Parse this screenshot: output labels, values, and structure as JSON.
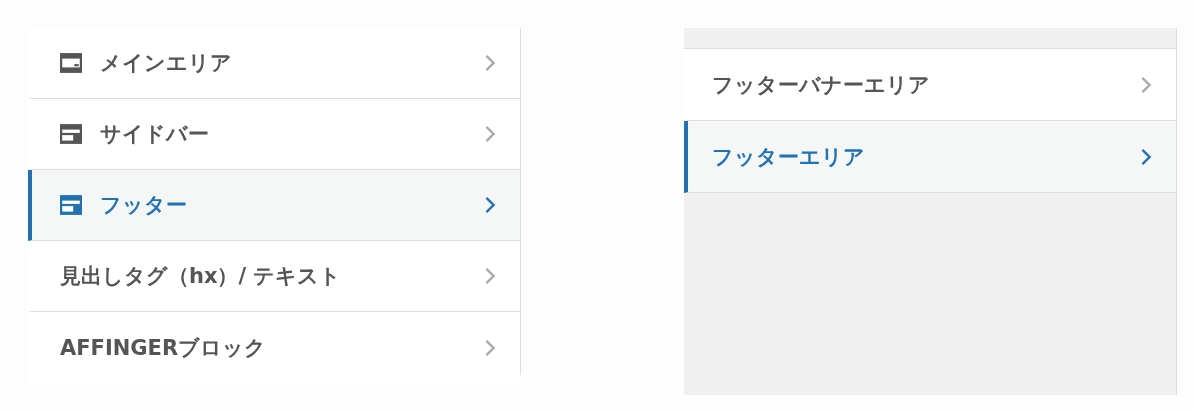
{
  "left_menu": {
    "items": [
      {
        "label": "メインエリア",
        "kind": "icon",
        "selected": false
      },
      {
        "label": "サイドバー",
        "kind": "icon",
        "selected": false
      },
      {
        "label": "フッター",
        "kind": "icon",
        "selected": true
      },
      {
        "label": "見出しタグ（hx）/ テキスト",
        "kind": "plain",
        "selected": false
      },
      {
        "label": "AFFINGERブロック",
        "kind": "plain",
        "selected": false
      }
    ]
  },
  "right_menu": {
    "items": [
      {
        "label": "フッターバナーエリア",
        "selected": false
      },
      {
        "label": "フッターエリア",
        "selected": true
      }
    ]
  }
}
